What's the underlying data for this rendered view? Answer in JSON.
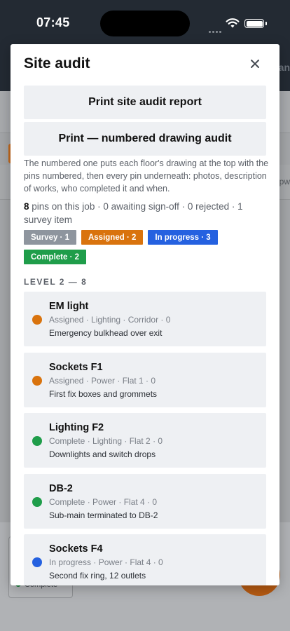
{
  "status_bar": {
    "time": "07:45"
  },
  "background": {
    "header_fragment": "an",
    "row_fragment": "pw",
    "status_chip": "Complete"
  },
  "modal": {
    "title": "Site audit",
    "print_site_audit": "Print site audit report",
    "print_numbered": "Print — numbered drawing audit",
    "description": "The numbered one puts each floor's drawing at the top with the pins numbered, then every pin underneath: photos, description of works, who completed it and when.",
    "summary": {
      "count": "8",
      "text": " pins on this job · 0 awaiting sign-off · 0 rejected · 1 survey item"
    },
    "chips": [
      {
        "label": "Survey · 1",
        "color": "#8e959e"
      },
      {
        "label": "Assigned · 2",
        "color": "#d9730d"
      },
      {
        "label": "In progress · 3",
        "color": "#2561e0"
      },
      {
        "label": "Complete · 2",
        "color": "#1f9d4a"
      }
    ],
    "section_label": "LEVEL 2 — 8",
    "pins": [
      {
        "name": "EM light",
        "meta": "Assigned · Lighting · Corridor · 0",
        "note": "Emergency bulkhead over exit",
        "status_color": "#d9730d"
      },
      {
        "name": "Sockets F1",
        "meta": "Assigned · Power · Flat 1 · 0",
        "note": "First fix boxes and grommets",
        "status_color": "#d9730d"
      },
      {
        "name": "Lighting F2",
        "meta": "Complete · Lighting · Flat 2 · 0",
        "note": "Downlights and switch drops",
        "status_color": "#1f9d4a"
      },
      {
        "name": "DB-2",
        "meta": "Complete · Power · Flat 4 · 0",
        "note": "Sub-main terminated to DB-2",
        "status_color": "#1f9d4a"
      },
      {
        "name": "Sockets F4",
        "meta": "In progress · Power · Flat 4 · 0",
        "note": "Second fix ring, 12 outlets",
        "status_color": "#2561e0"
      }
    ]
  }
}
